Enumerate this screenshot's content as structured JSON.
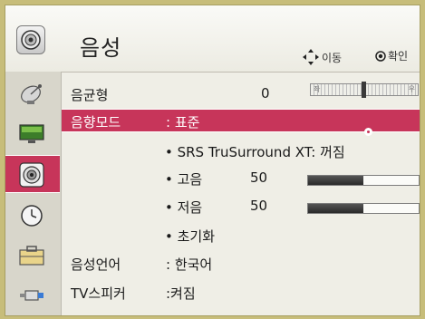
{
  "header": {
    "title": "음성",
    "hint_move": "이동",
    "hint_ok": "확인"
  },
  "menu": {
    "eq_label": "음균형",
    "eq_value": "0",
    "balance_left": "좌",
    "balance_right": "우",
    "sound_mode_label": "음향모드",
    "sound_mode_value": ": 표준",
    "srs_label": "• SRS TruSurround XT: 꺼짐",
    "treble_label": "• 고음",
    "treble_value": "50",
    "bass_label": "• 저음",
    "bass_value": "50",
    "reset_label": "• 초기화",
    "language_label": "음성언어",
    "language_value": ": 한국어",
    "tv_speaker_label": "TV스피커",
    "tv_speaker_value": ":켜짐",
    "treble_level": 0.5,
    "bass_level": 0.5,
    "balance_level": 0.5
  },
  "sidebar": {
    "items": [
      "satellite-dish-icon",
      "monitor-icon",
      "speaker-icon",
      "clock-icon",
      "toolbox-icon",
      "connector-icon"
    ],
    "active_index": 2
  },
  "colors": {
    "accent": "#c7355a",
    "frame": "#c7bd7a",
    "panel": "#efeee6"
  }
}
